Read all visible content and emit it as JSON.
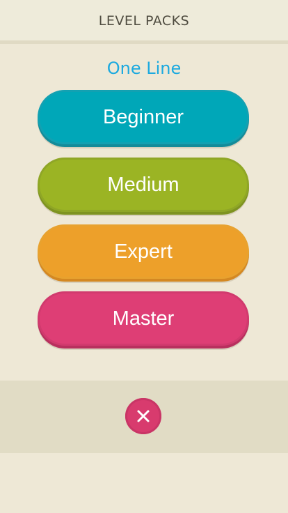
{
  "header": {
    "title": "LEVEL PACKS"
  },
  "subtitle": "One Line",
  "packs": [
    {
      "label": "Beginner",
      "color": "#00A7B8"
    },
    {
      "label": "Medium",
      "color": "#9BB424"
    },
    {
      "label": "Expert",
      "color": "#EDA02A"
    },
    {
      "label": "Master",
      "color": "#DE3E75"
    }
  ],
  "footer": {
    "close_icon": "close-icon",
    "close_color": "#D83B6E"
  },
  "colors": {
    "background": "#EEE8D6",
    "accent_text": "#1BA9DF"
  }
}
